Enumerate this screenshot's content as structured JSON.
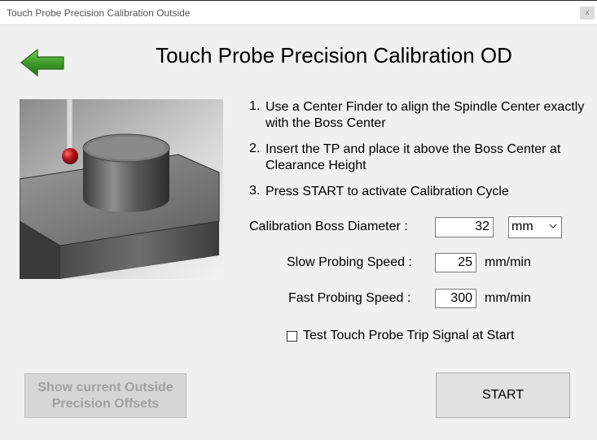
{
  "window": {
    "title": "Touch Probe Precision Calibration Outside",
    "close_glyph": "x"
  },
  "heading": "Touch Probe Precision Calibration OD",
  "back_icon": "back-arrow-icon",
  "steps": [
    {
      "num": "1.",
      "text": "Use a Center Finder to align the Spindle Center exactly with the Boss Center"
    },
    {
      "num": "2.",
      "text": "Insert the TP and place it above the Boss Center at Clearance Height"
    },
    {
      "num": "3.",
      "text": "Press START to activate Calibration Cycle"
    }
  ],
  "form": {
    "diameter_label": "Calibration Boss Diameter :",
    "diameter_value": "32",
    "diameter_unit": "mm",
    "slow_label": "Slow Probing Speed :",
    "slow_value": "25",
    "slow_unit": "mm/min",
    "fast_label": "Fast Probing Speed :",
    "fast_value": "300",
    "fast_unit": "mm/min",
    "test_trip_label": "Test Touch Probe Trip Signal at Start",
    "test_trip_checked": false
  },
  "buttons": {
    "show_offsets": "Show current Outside Precision Offsets",
    "start": "START"
  },
  "colors": {
    "arrow_green": "#3f9b2a",
    "probe_ball_red": "#b3161b"
  }
}
